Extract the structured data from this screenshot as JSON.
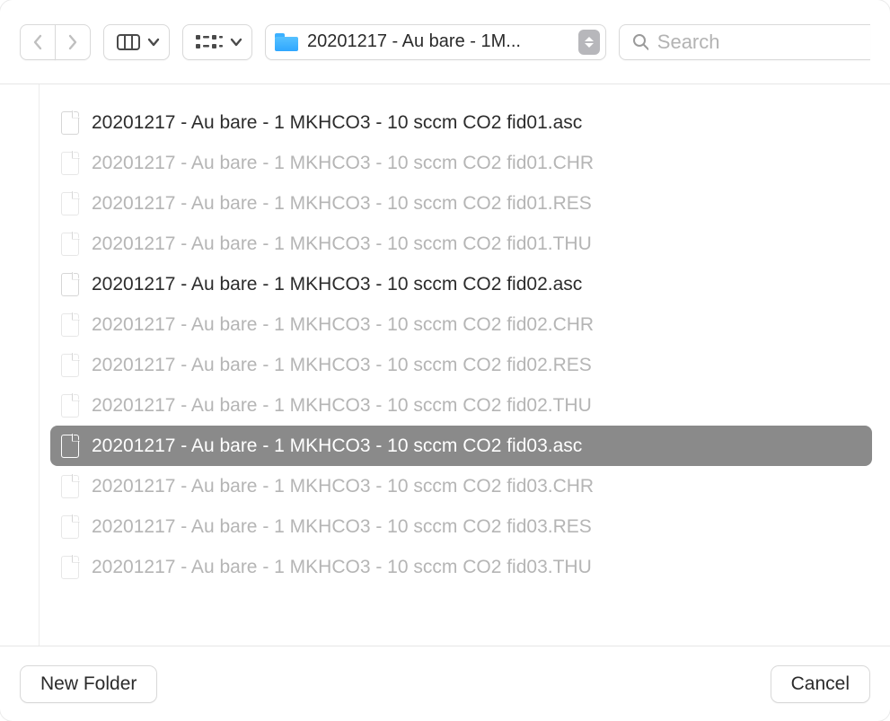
{
  "toolbar": {
    "path_label": "20201217 - Au bare - 1M...",
    "search_placeholder": "Search"
  },
  "files": [
    {
      "name": "20201217 - Au bare - 1 MKHCO3 - 10 sccm CO2 fid01.asc",
      "enabled": true,
      "selected": false
    },
    {
      "name": "20201217 - Au bare - 1 MKHCO3 - 10 sccm CO2 fid01.CHR",
      "enabled": false,
      "selected": false
    },
    {
      "name": "20201217 - Au bare - 1 MKHCO3 - 10 sccm CO2 fid01.RES",
      "enabled": false,
      "selected": false
    },
    {
      "name": "20201217 - Au bare - 1 MKHCO3 - 10 sccm CO2 fid01.THU",
      "enabled": false,
      "selected": false
    },
    {
      "name": "20201217 - Au bare - 1 MKHCO3 - 10 sccm CO2 fid02.asc",
      "enabled": true,
      "selected": false
    },
    {
      "name": "20201217 - Au bare - 1 MKHCO3 - 10 sccm CO2 fid02.CHR",
      "enabled": false,
      "selected": false
    },
    {
      "name": "20201217 - Au bare - 1 MKHCO3 - 10 sccm CO2 fid02.RES",
      "enabled": false,
      "selected": false
    },
    {
      "name": "20201217 - Au bare - 1 MKHCO3 - 10 sccm CO2 fid02.THU",
      "enabled": false,
      "selected": false
    },
    {
      "name": "20201217 - Au bare - 1 MKHCO3 - 10 sccm CO2 fid03.asc",
      "enabled": true,
      "selected": true
    },
    {
      "name": "20201217 - Au bare - 1 MKHCO3 - 10 sccm CO2 fid03.CHR",
      "enabled": false,
      "selected": false
    },
    {
      "name": "20201217 - Au bare - 1 MKHCO3 - 10 sccm CO2 fid03.RES",
      "enabled": false,
      "selected": false
    },
    {
      "name": "20201217 - Au bare - 1 MKHCO3 - 10 sccm CO2 fid03.THU",
      "enabled": false,
      "selected": false
    }
  ],
  "footer": {
    "new_folder_label": "New Folder",
    "cancel_label": "Cancel"
  }
}
